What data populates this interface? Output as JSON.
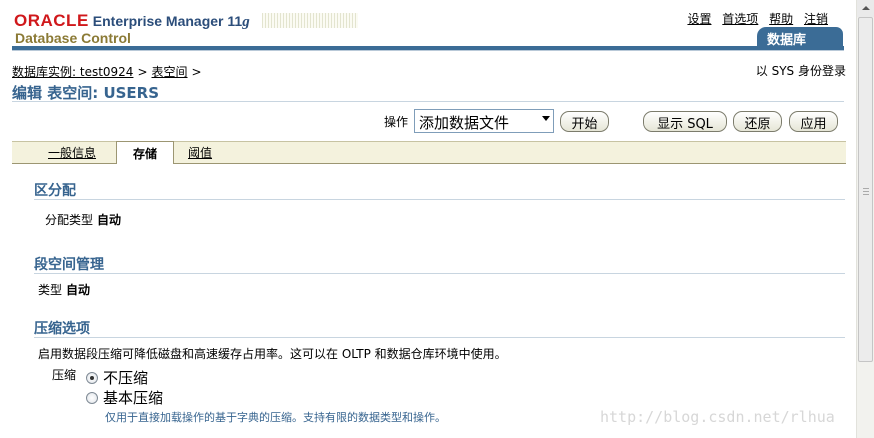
{
  "brand": {
    "oracle": "ORACLE",
    "product": "Enterprise Manager 11",
    "version_suffix": "g",
    "subtitle": "Database Control"
  },
  "global_links": [
    "设置",
    "首选项",
    "帮助",
    "注销"
  ],
  "db_tab": "数据库",
  "breadcrumb": {
    "instance": "数据库实例: test0924",
    "tablespace": "表空间",
    "sep": ">"
  },
  "login_info": "以 SYS 身份登录",
  "page_title": "编辑 表空间: USERS",
  "actions": {
    "label": "操作",
    "selected": "添加数据文件",
    "start": "开始",
    "show_sql": "显示 SQL",
    "revert": "还原",
    "apply": "应用"
  },
  "tabs": {
    "general": "一般信息",
    "storage": "存储",
    "threshold": "阈值",
    "active": "storage"
  },
  "extent": {
    "heading": "区分配",
    "label": "分配类型",
    "value": "自动"
  },
  "segment": {
    "heading": "段空间管理",
    "label": "类型",
    "value": "自动"
  },
  "compression": {
    "heading": "压缩选项",
    "description": "启用数据段压缩可降低磁盘和高速缓存占用率。这可以在 OLTP 和数据仓库环境中使用。",
    "label": "压缩",
    "options": [
      "不压缩",
      "基本压缩"
    ],
    "selected": "不压缩",
    "note": "仅用于直接加载操作的基于字典的压缩。支持有限的数据类型和操作。"
  },
  "watermark": "http://blog.csdn.net/rlhua",
  "colors": {
    "brand_red": "#d0181b",
    "header_blue": "#3b6c96",
    "heading_blue": "#37648f",
    "subtitle_olive": "#8b7a35",
    "tab_bar": "#f4f2dd"
  }
}
